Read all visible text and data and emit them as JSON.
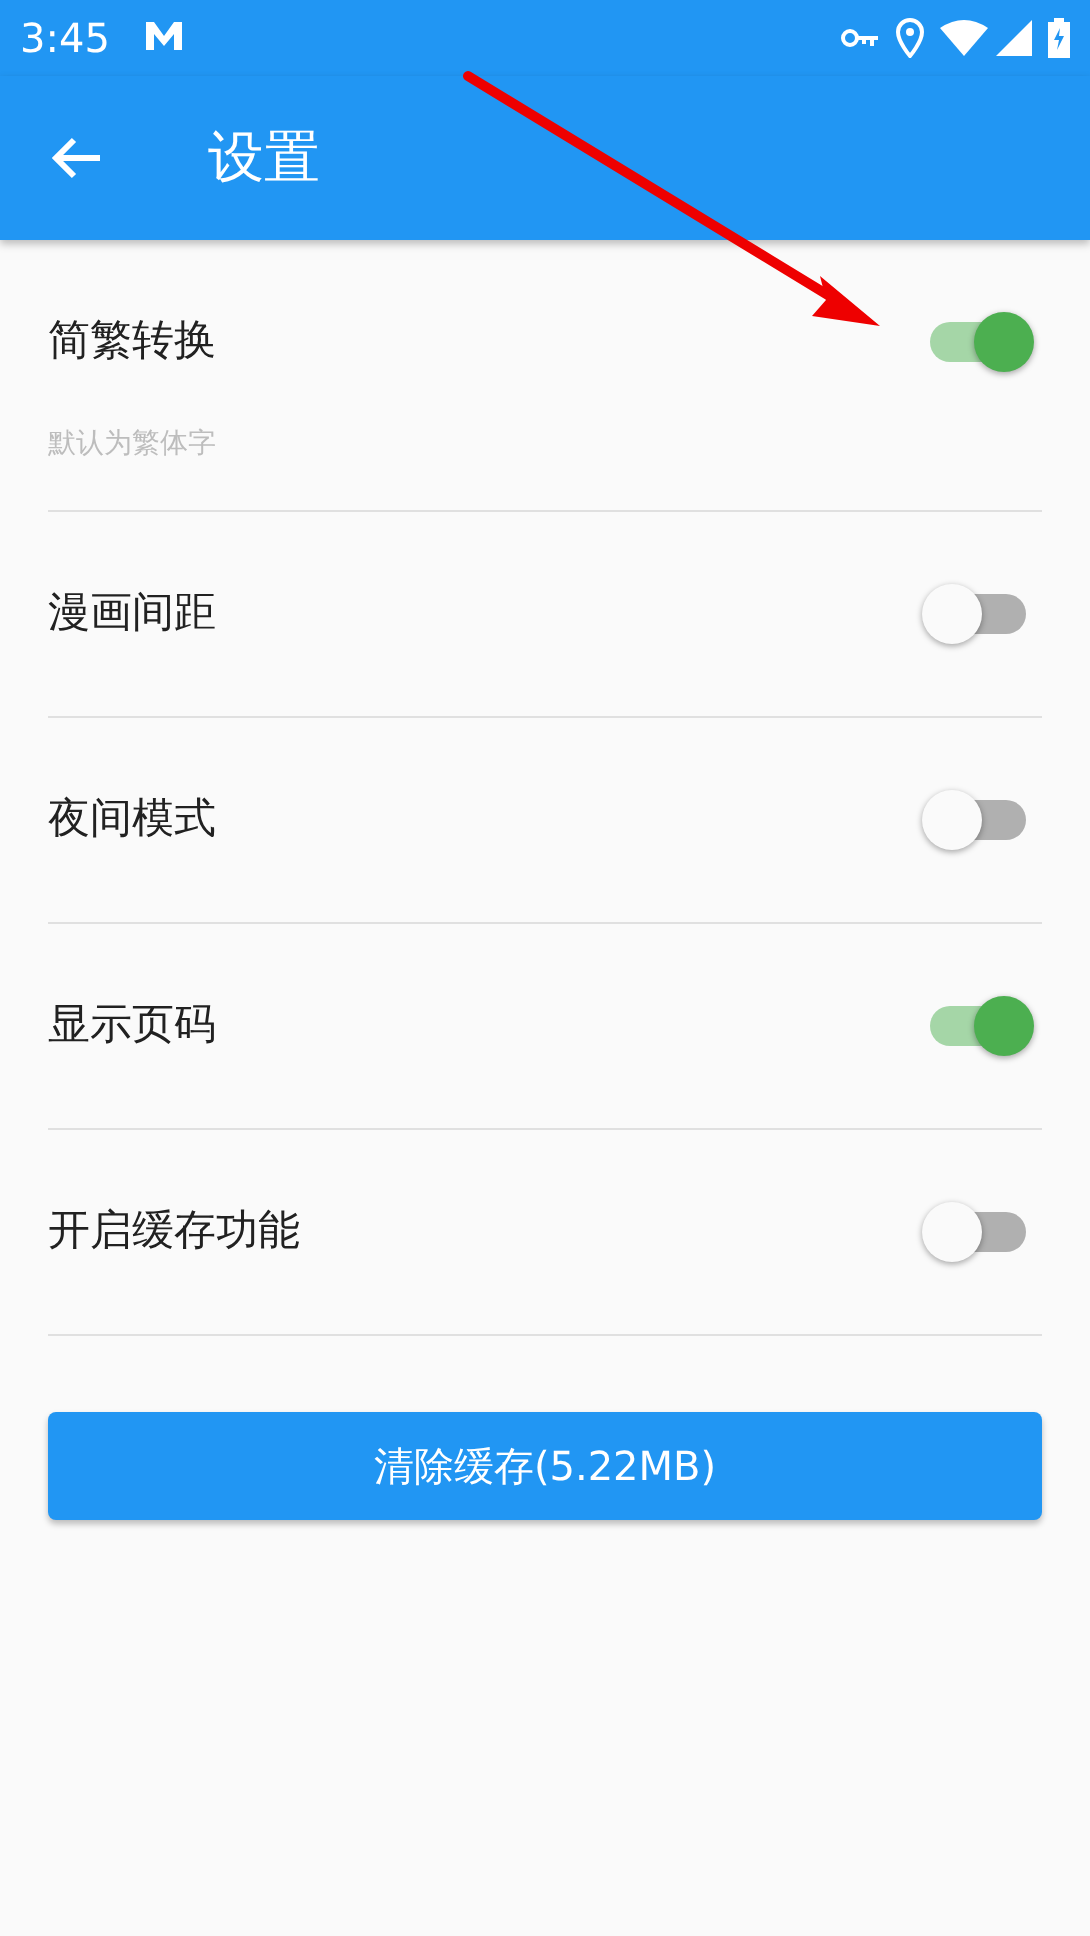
{
  "status_bar": {
    "time": "3:45"
  },
  "app_bar": {
    "title": "设置"
  },
  "settings": [
    {
      "label": "简繁转换",
      "hint": "默认为繁体字",
      "on": true
    },
    {
      "label": "漫画间距",
      "on": false
    },
    {
      "label": "夜间模式",
      "on": false
    },
    {
      "label": "显示页码",
      "on": true
    },
    {
      "label": "开启缓存功能",
      "on": false
    }
  ],
  "clear_button": {
    "label": "清除缓存(5.22MB)"
  }
}
